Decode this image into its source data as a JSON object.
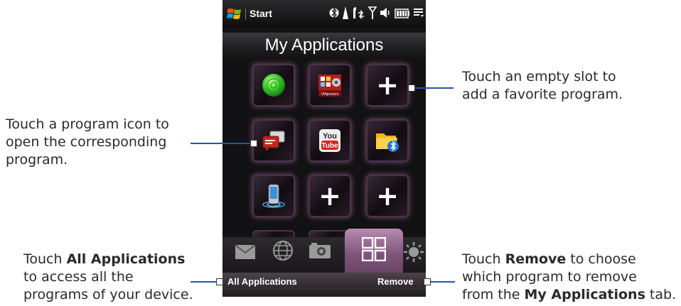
{
  "phone": {
    "status": {
      "start_label": "Start"
    },
    "title": "My Applications",
    "tiles": [
      {
        "kind": "green-orb-app-icon"
      },
      {
        "kind": "viaprograms-app-icon",
        "badge_text": "VIAprovers"
      },
      {
        "kind": "plus",
        "label": "+"
      },
      {
        "kind": "messaging-app-icon"
      },
      {
        "kind": "youtube-app-icon",
        "line1": "You",
        "line2": "Tube"
      },
      {
        "kind": "bluetooth-folder-icon"
      },
      {
        "kind": "phone-device-icon"
      },
      {
        "kind": "plus",
        "label": "+"
      },
      {
        "kind": "plus",
        "label": "+"
      }
    ],
    "softkeys": {
      "left": "All Applications",
      "right": "Remove"
    }
  },
  "callouts": {
    "empty_slot": {
      "line1": "Touch an empty slot to",
      "line2": "add a favorite program."
    },
    "program_icon": {
      "line1": "Touch a program icon to",
      "line2": "open the corresponding",
      "line3": "program."
    },
    "all_apps": {
      "pre": "Touch ",
      "bold": "All Applications",
      "line2": "to access all the",
      "line3": "programs of your device."
    },
    "remove": {
      "pre": "Touch ",
      "bold": "Remove",
      "post": " to choose",
      "line2": "which program to remove",
      "line3_pre": "from the ",
      "line3_bold": "My Applications",
      "line3_post": " tab."
    }
  },
  "colors": {
    "leader": "#2456a6",
    "tab_highlight": "#8e5f88",
    "phone_bg": "#141214"
  }
}
